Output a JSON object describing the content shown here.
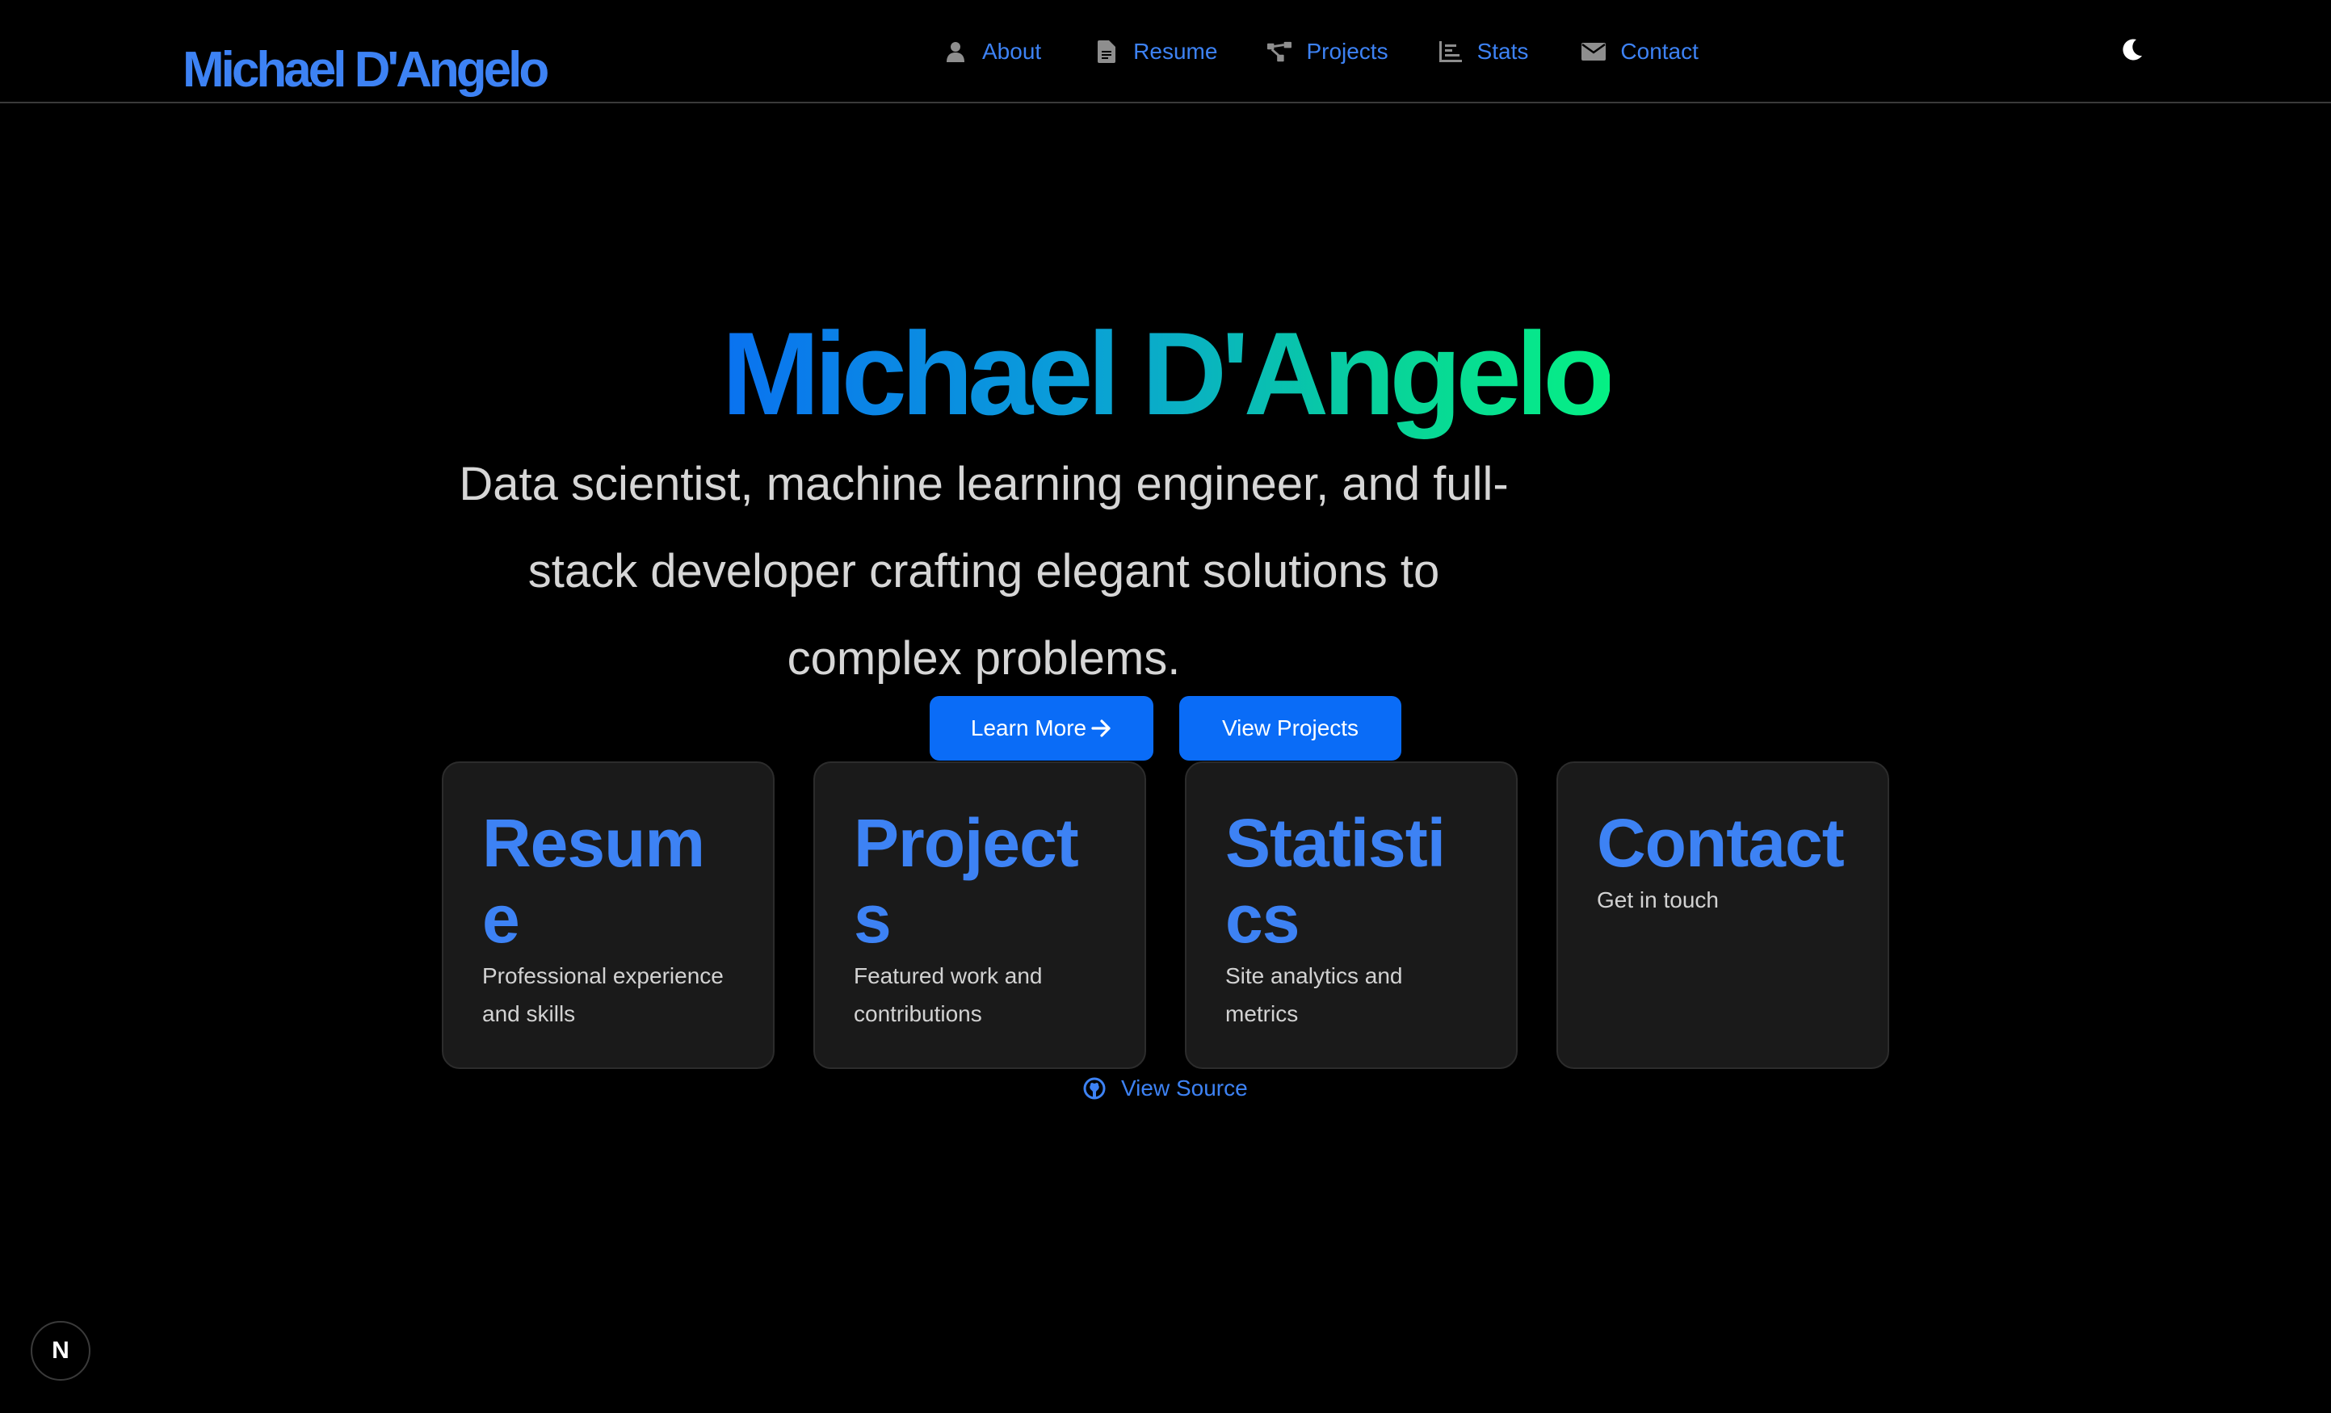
{
  "header": {
    "brand": "Michael D'Angelo",
    "nav": [
      {
        "label": "About",
        "icon": "user-icon"
      },
      {
        "label": "Resume",
        "icon": "document-icon"
      },
      {
        "label": "Projects",
        "icon": "project-graph-icon"
      },
      {
        "label": "Stats",
        "icon": "chart-icon"
      },
      {
        "label": "Contact",
        "icon": "envelope-icon"
      }
    ],
    "theme_toggle_icon": "moon-icon"
  },
  "hero": {
    "title": "Michael D'Angelo",
    "subtitle": "Data scientist, machine learning engineer, and full-stack developer crafting elegant solutions to complex problems.",
    "learn_more": "Learn More",
    "view_projects": "View Projects"
  },
  "cards": [
    {
      "title": "Resume",
      "description": "Professional experience and skills"
    },
    {
      "title": "Projects",
      "description": "Featured work and contributions"
    },
    {
      "title": "Statistics",
      "description": "Site analytics and metrics"
    },
    {
      "title": "Contact",
      "description": "Get in touch"
    }
  ],
  "footer": {
    "view_source": "View Source",
    "view_source_icon": "github-icon"
  },
  "dev_badge": {
    "label": "N",
    "icon": "nextjs-icon"
  },
  "colors": {
    "background": "#000000",
    "accent": "#3d82f4",
    "button": "#0a6cf7",
    "card": "#1a1a1a",
    "gradient_start": "#0a72f0",
    "gradient_end": "#05f084"
  }
}
